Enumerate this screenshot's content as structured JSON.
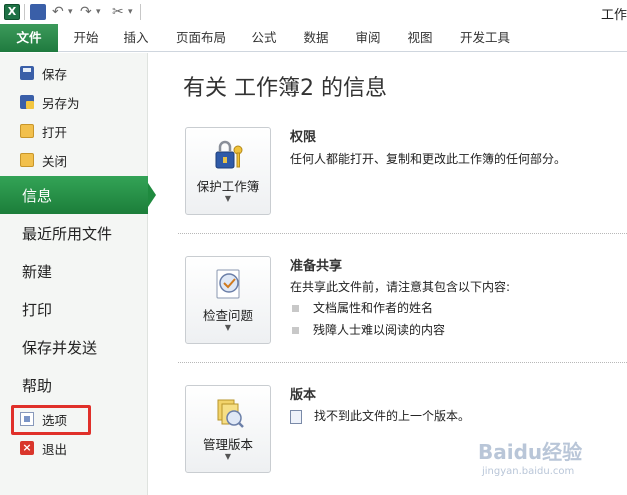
{
  "window": {
    "title": "工作"
  },
  "quick_access": {
    "icons": [
      "excel-logo",
      "save-icon",
      "undo-icon",
      "redo-icon",
      "customize-icon"
    ]
  },
  "ribbon": {
    "tabs": [
      {
        "label": "文件",
        "active": true
      },
      {
        "label": "开始"
      },
      {
        "label": "插入"
      },
      {
        "label": "页面布局"
      },
      {
        "label": "公式"
      },
      {
        "label": "数据"
      },
      {
        "label": "审阅"
      },
      {
        "label": "视图"
      },
      {
        "label": "开发工具"
      }
    ]
  },
  "sidebar": {
    "items": [
      {
        "label": "保存",
        "icon": "save-icon"
      },
      {
        "label": "另存为",
        "icon": "save-as-icon"
      },
      {
        "label": "打开",
        "icon": "open-folder-icon"
      },
      {
        "label": "关闭",
        "icon": "close-folder-icon"
      },
      {
        "label": "信息",
        "active": true
      },
      {
        "label": "最近所用文件"
      },
      {
        "label": "新建"
      },
      {
        "label": "打印"
      },
      {
        "label": "保存并发送"
      },
      {
        "label": "帮助"
      },
      {
        "label": "选项",
        "icon": "options-icon",
        "highlighted": true
      },
      {
        "label": "退出",
        "icon": "exit-icon"
      }
    ]
  },
  "main": {
    "title": "有关 工作簿2 的信息",
    "sections": [
      {
        "button_label": "保护工作簿",
        "icon": "lock-keys-icon",
        "title": "权限",
        "description": "任何人都能打开、复制和更改此工作簿的任何部分。"
      },
      {
        "button_label": "检查问题",
        "icon": "inspect-document-icon",
        "title": "准备共享",
        "description": "在共享此文件前，请注意其包含以下内容:",
        "bullets": [
          "文档属性和作者的姓名",
          "残障人士难以阅读的内容"
        ]
      },
      {
        "button_label": "管理版本",
        "icon": "manage-versions-icon",
        "title": "版本",
        "description": "找不到此文件的上一个版本。"
      }
    ]
  },
  "watermark": {
    "text": "Baidu经验",
    "sub": "jingyan.baidu.com"
  },
  "colors": {
    "accent_green": "#1f8a3f",
    "highlight_red": "#e0302a"
  }
}
